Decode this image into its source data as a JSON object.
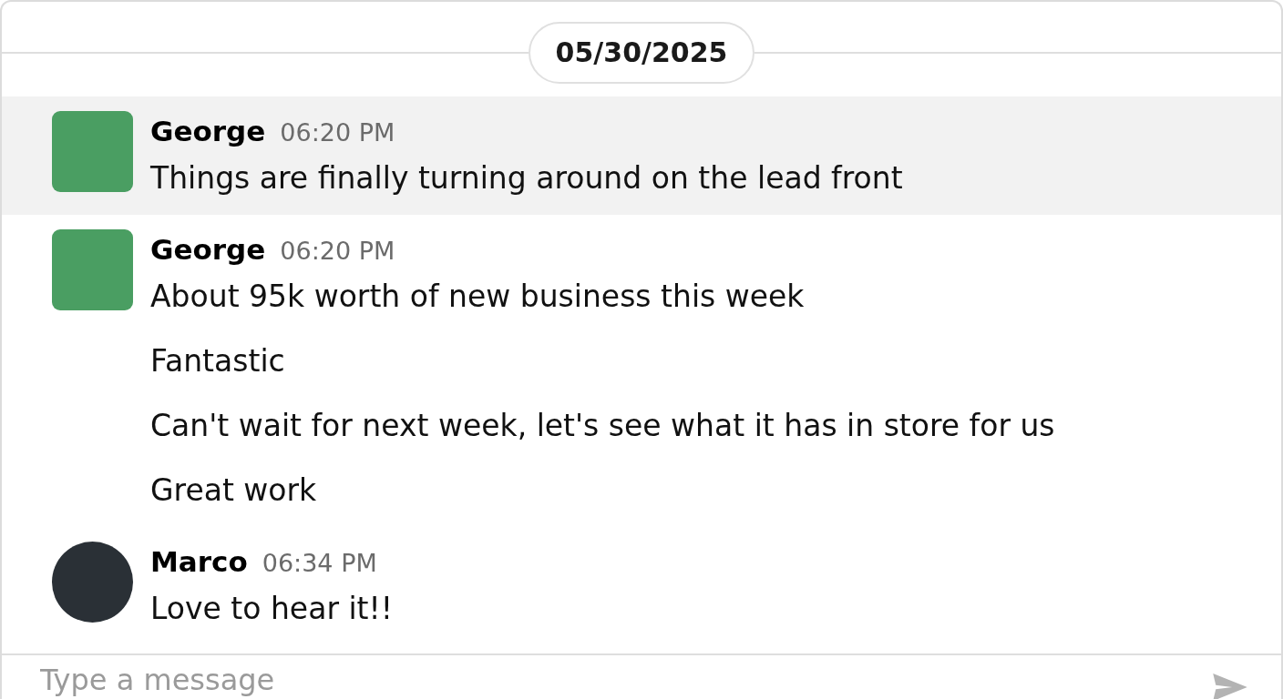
{
  "date_divider": {
    "label": "05/30/2025"
  },
  "messages": [
    {
      "author": "George",
      "time": "06:20 PM",
      "avatar": {
        "kind": "square",
        "color": "#4a9e62"
      },
      "highlighted": true,
      "lines": [
        "Things are finally turning around on the lead front"
      ]
    },
    {
      "author": "George",
      "time": "06:20 PM",
      "avatar": {
        "kind": "square",
        "color": "#4a9e62"
      },
      "highlighted": false,
      "lines": [
        "About 95k worth of new business this week",
        "Fantastic",
        "Can't wait for next week, let's see what it has in store for us",
        "Great work"
      ]
    },
    {
      "author": "Marco",
      "time": "06:34 PM",
      "avatar": {
        "kind": "circle",
        "color": "#2a3036"
      },
      "highlighted": false,
      "lines": [
        "Love to hear it!!"
      ]
    }
  ],
  "composer": {
    "placeholder": "Type a message"
  }
}
